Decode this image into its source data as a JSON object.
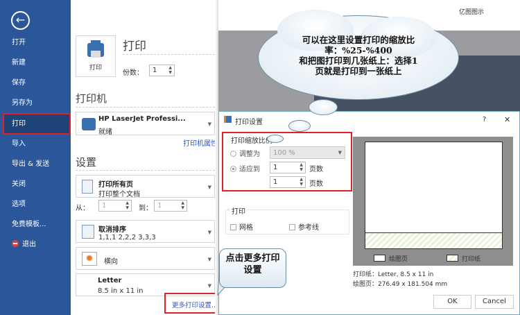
{
  "app_title": "亿图图示",
  "sidebar": {
    "items": [
      "打开",
      "新建",
      "保存",
      "另存为",
      "打印",
      "导入",
      "导出 & 发送",
      "关闭",
      "选项",
      "免费模板...",
      "退出"
    ]
  },
  "print": {
    "button_label": "打印",
    "title": "打印",
    "copies_label": "份数：",
    "copies": "1"
  },
  "printer": {
    "heading": "打印机",
    "name": "HP LaserJet Professi...",
    "status": "就绪",
    "properties_link": "打印机属性"
  },
  "settings": {
    "heading": "设置",
    "pages_title": "打印所有页",
    "pages_sub": "打印整个文档",
    "from_label": "从：",
    "from": "1",
    "to_label": "到：",
    "to": "1",
    "collate_title": "取消排序",
    "collate_sub": "1,1,1   2,2,2   3,3,3",
    "orientation": "横向",
    "paper_title": "Letter",
    "paper_sub": "8.5 in x 11 in",
    "more_link": "更多打印设置..."
  },
  "dialog": {
    "title": "打印设置",
    "help": "?",
    "close": "✕",
    "scale_group": "打印缩放比例",
    "adjust_label": "调整为",
    "adjust_value": "100 %",
    "fit_label": "适应到",
    "fit_w": "1",
    "fit_h": "1",
    "pages_unit": "页数",
    "print_group": "打印",
    "grid_label": "网格",
    "guides_label": "参考线",
    "legend_page": "绘图页",
    "legend_paper": "打印纸",
    "paper_info": "打印纸：Letter, 8.5 x 11 in",
    "page_info": "绘图页：276.49 x 181.504 mm",
    "ok": "OK",
    "cancel": "Cancel"
  },
  "annotations": {
    "cloud_lines": [
      "可以在这里设置打印的缩放比",
      "率：%25-%400",
      "和把图打印到几张纸上：选择1",
      "页就是打印到一张纸上"
    ],
    "callout_lines": [
      "点击更多打印",
      "设置"
    ]
  }
}
